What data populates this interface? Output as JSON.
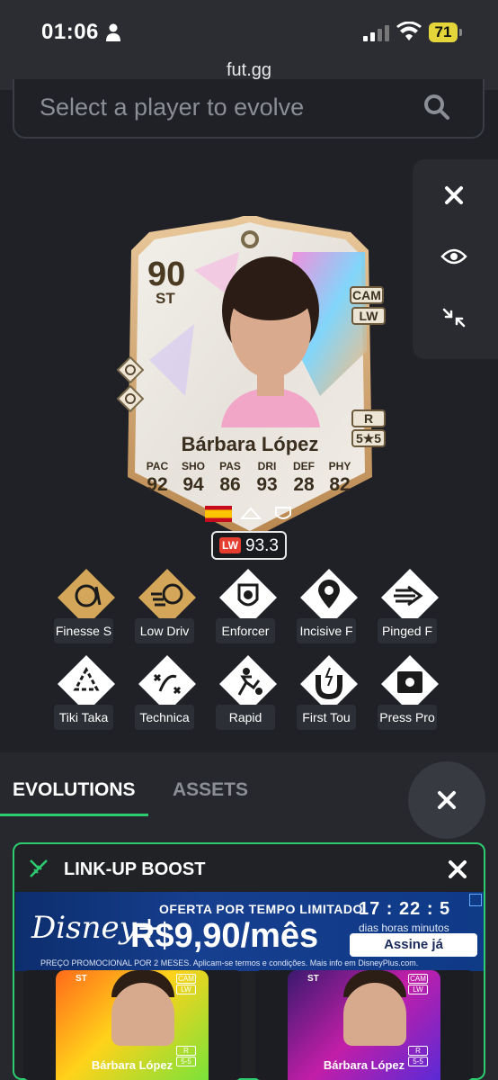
{
  "status_bar": {
    "time": "01:06",
    "battery": "71",
    "url": "fut.gg"
  },
  "search": {
    "placeholder": "Select a player to evolve"
  },
  "side_panel": {
    "icons": [
      "close-icon",
      "eye-icon",
      "collapse-icon"
    ]
  },
  "card": {
    "rating": "90",
    "position": "ST",
    "alt_positions": [
      "CAM",
      "LW"
    ],
    "foot": "R",
    "skills_weakfoot": "5★5",
    "name": "Bárbara López",
    "stats": [
      {
        "label": "PAC",
        "value": "92"
      },
      {
        "label": "SHO",
        "value": "94"
      },
      {
        "label": "PAS",
        "value": "86"
      },
      {
        "label": "DRI",
        "value": "93"
      },
      {
        "label": "DEF",
        "value": "28"
      },
      {
        "label": "PHY",
        "value": "82"
      }
    ],
    "chem": {
      "position": "LW",
      "value": "93.3"
    }
  },
  "playstyles": [
    {
      "label": "Finesse S",
      "plus": true
    },
    {
      "label": "Low Driv",
      "plus": true
    },
    {
      "label": "Enforcer",
      "plus": false
    },
    {
      "label": "Incisive F",
      "plus": false
    },
    {
      "label": "Pinged F",
      "plus": false
    },
    {
      "label": "Tiki Taka",
      "plus": false
    },
    {
      "label": "Technica",
      "plus": false
    },
    {
      "label": "Rapid",
      "plus": false
    },
    {
      "label": "First Tou",
      "plus": false
    },
    {
      "label": "Press Pro",
      "plus": false
    }
  ],
  "tabs": {
    "evolutions": "EVOLUTIONS",
    "assets": "ASSETS"
  },
  "evo": {
    "title": "LINK-UP BOOST"
  },
  "ad": {
    "brand": "Disney+",
    "offer": "OFERTA POR TEMPO LIMITADO",
    "price": "R$9,90/mês",
    "timer": "17 : 22 : 5",
    "timer_units": "dias   horas   minutos",
    "cta": "Assine já",
    "fine": "PREÇO PROMOCIONAL POR 2 MESES. Aplicam-se termos e condições. Mais info em DisneyPlus.com."
  },
  "mini_cards": [
    {
      "name": "Bárbara López",
      "position": "ST",
      "alt": [
        "CAM",
        "LW"
      ],
      "foot": "R",
      "sw": "5-5"
    },
    {
      "name": "Bárbara López",
      "position": "ST",
      "alt": [
        "CAM",
        "LW"
      ],
      "foot": "R",
      "sw": "5-5"
    }
  ]
}
